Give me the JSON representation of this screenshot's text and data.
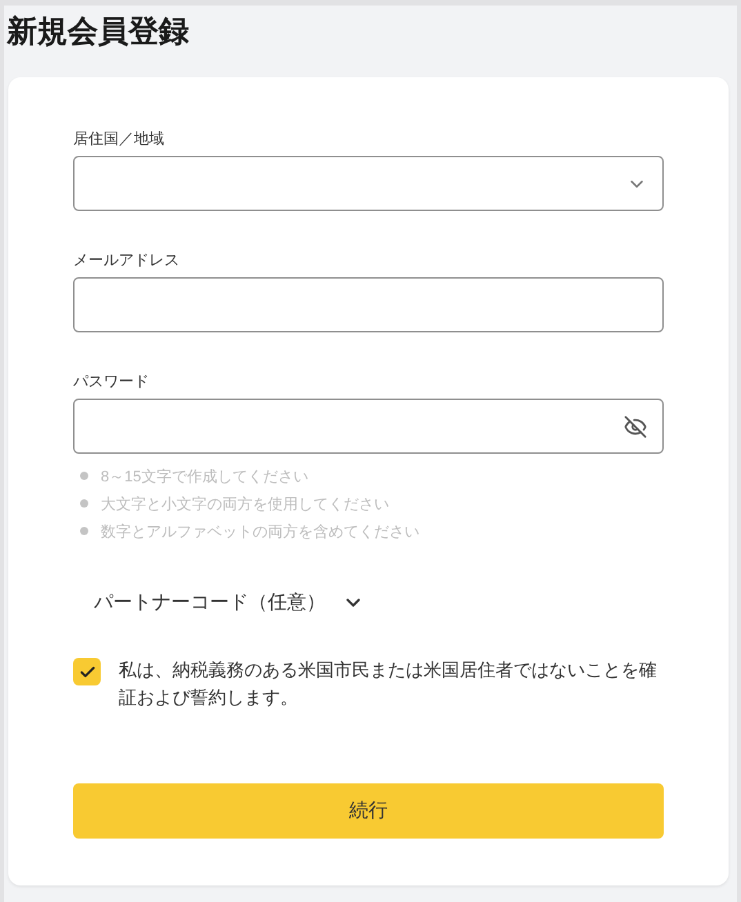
{
  "title": "新規会員登録",
  "fields": [
    {
      "kind": "select",
      "label": "居住国／地域"
    },
    {
      "kind": "text",
      "label": "メールアドレス"
    },
    {
      "kind": "password",
      "label": "パスワード",
      "password_hidden": true
    }
  ],
  "password_rules": [
    "8～15文字で作成してください",
    "大文字と小文字の両方を使用してください",
    "数字とアルファベットの両方を含めてください"
  ],
  "partner_code": {
    "label": "パートナーコード（任意）",
    "expanded": false
  },
  "agreement": {
    "checked": true,
    "text": "私は、納税義務のある米国市民または米国居住者ではないことを確証および誓約します。"
  },
  "submit": {
    "label": "続行"
  }
}
